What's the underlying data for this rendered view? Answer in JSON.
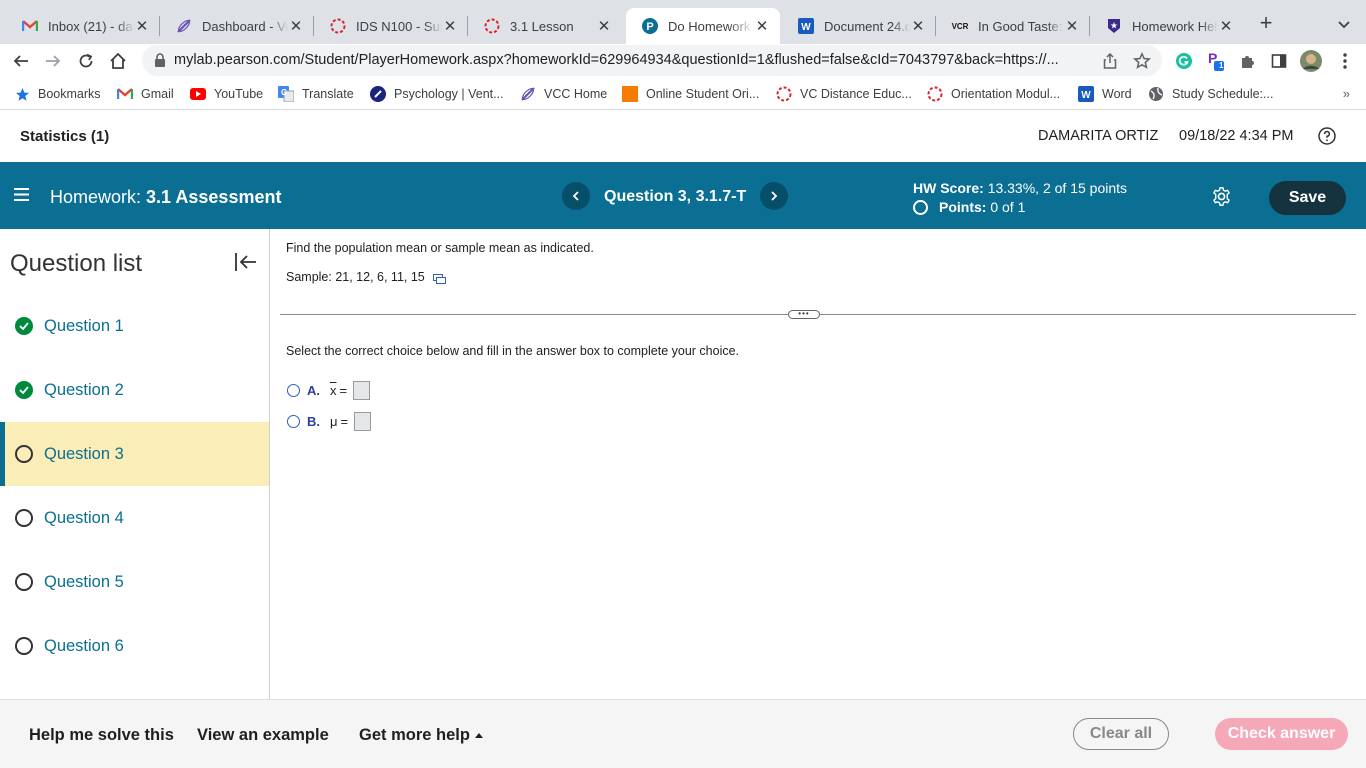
{
  "browser": {
    "tabs": [
      {
        "title": "Inbox (21) - dam",
        "icon": "gmail-icon"
      },
      {
        "title": "Dashboard - Ve",
        "icon": "vcc-icon"
      },
      {
        "title": "IDS N100 - Supe",
        "icon": "vcc-ring-icon"
      },
      {
        "title": "3.1 Lesson",
        "icon": "vcc-ring-icon"
      },
      {
        "title": "Do Homework -",
        "icon": "pearson-icon",
        "active": true
      },
      {
        "title": "Document 24.d",
        "icon": "word-icon"
      },
      {
        "title": "In Good Taste: A",
        "icon": "vcr-icon",
        "icon_text": "VCR"
      },
      {
        "title": "Homework Help",
        "icon": "star-shield-icon"
      }
    ],
    "url_host": "mylab.pearson.com",
    "url_path": "/Student/PlayerHomework.aspx?homeworkId=629964934&questionId=1&flushed=false&cId=7043797&back=https://...",
    "bookmarks": [
      {
        "label": "Bookmarks",
        "icon": "star-icon"
      },
      {
        "label": "Gmail",
        "icon": "gmail-icon"
      },
      {
        "label": "YouTube",
        "icon": "youtube-icon"
      },
      {
        "label": "Translate",
        "icon": "translate-icon"
      },
      {
        "label": "Psychology | Vent...",
        "icon": "psychology-icon"
      },
      {
        "label": "VCC Home",
        "icon": "vcc-icon"
      },
      {
        "label": "Online Student Ori...",
        "icon": "orange-square-icon"
      },
      {
        "label": "VC Distance Educ...",
        "icon": "vcc-ring-icon"
      },
      {
        "label": "Orientation Modul...",
        "icon": "vcc-ring-icon"
      },
      {
        "label": "Word",
        "icon": "word-icon"
      },
      {
        "label": "Study Schedule:...",
        "icon": "globe-icon"
      }
    ],
    "bookmarks_more": "»",
    "extension_badge": "1"
  },
  "header": {
    "course": "Statistics (1)",
    "user": "DAMARITA ORTIZ",
    "datetime": "09/18/22 4:34 PM"
  },
  "hw_bar": {
    "homework_prefix": "Homework:",
    "homework_name": "3.1 Assessment",
    "question_label": "Question 3, 3.1.7-T",
    "score_label": "HW Score:",
    "score_value": "13.33%, 2 of 15 points",
    "points_label": "Points:",
    "points_value": "0 of 1",
    "save_label": "Save"
  },
  "sidebar": {
    "title": "Question list",
    "questions": [
      {
        "label": "Question 1",
        "status": "correct"
      },
      {
        "label": "Question 2",
        "status": "correct"
      },
      {
        "label": "Question 3",
        "status": "current"
      },
      {
        "label": "Question 4",
        "status": "open"
      },
      {
        "label": "Question 5",
        "status": "open"
      },
      {
        "label": "Question 6",
        "status": "open"
      }
    ]
  },
  "question": {
    "prompt": "Find the population mean or sample mean as indicated.",
    "sample_text": "Sample: 21, 12, 6, 11, 15",
    "handle_text": "•••",
    "instruction": "Select the correct choice below and fill in the answer box to complete your choice.",
    "choices": [
      {
        "letter": "A.",
        "symbol": "x",
        "equals": "="
      },
      {
        "letter": "B.",
        "symbol": "μ",
        "equals": "="
      }
    ]
  },
  "footer": {
    "help_solve": "Help me solve this",
    "view_example": "View an example",
    "more_help": "Get more help",
    "clear_all": "Clear all",
    "check_answer": "Check answer"
  },
  "colors": {
    "primary": "#0a6f92",
    "save_bg": "#15323f",
    "current_bg": "#fbedb8",
    "correct": "#008a3e",
    "check_btn": "#f5a8b8"
  }
}
